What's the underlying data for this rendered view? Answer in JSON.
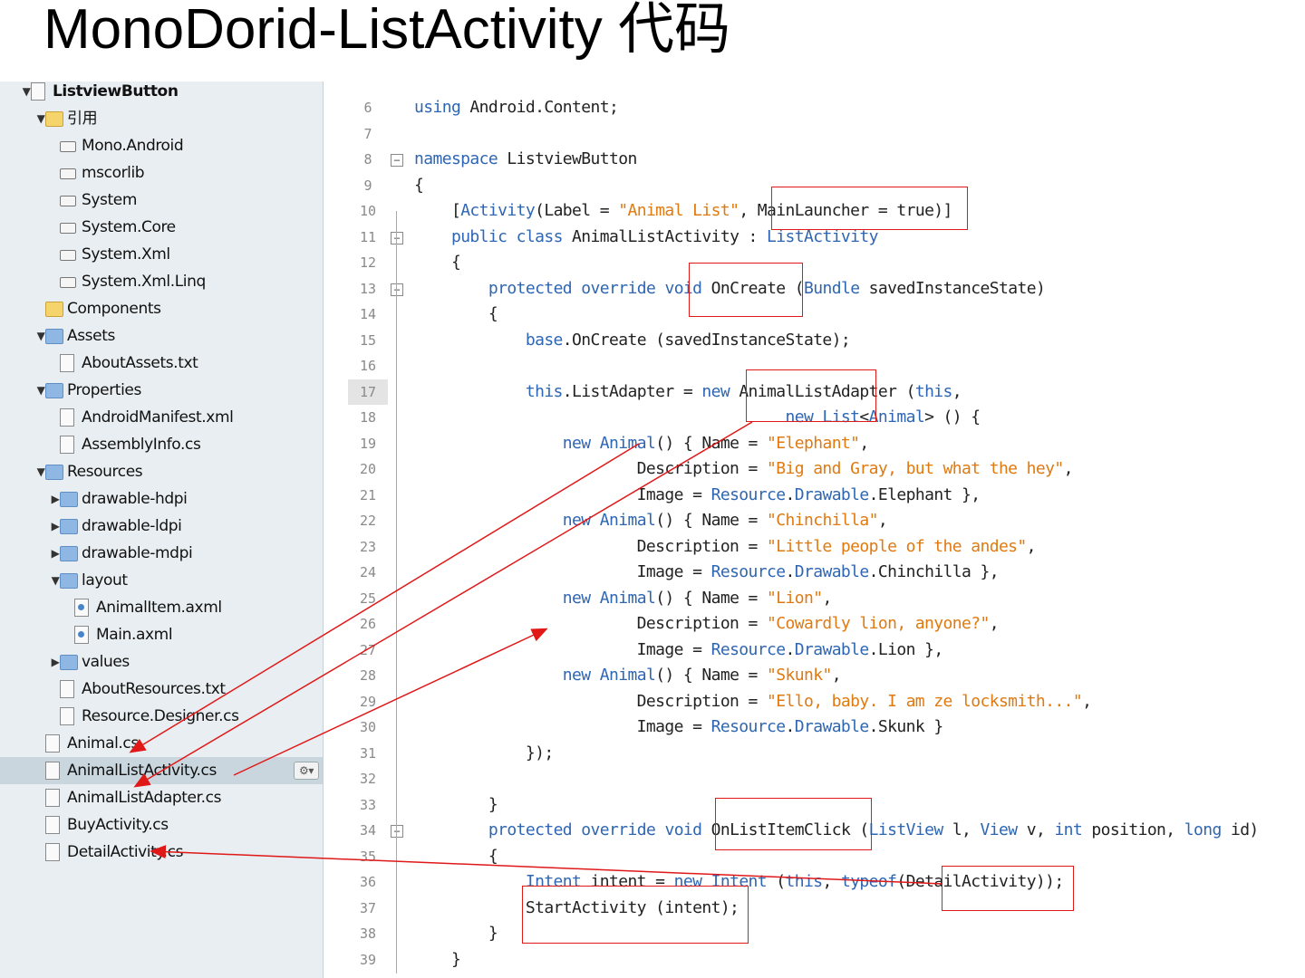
{
  "slide": {
    "title": "MonoDorid-ListActivity 代码"
  },
  "solution_tree": [
    {
      "label": "ListviewButton",
      "arrow": "▼",
      "icon": "project-icon"
    },
    {
      "label": "引用",
      "arrow": "▼",
      "icon": "folder-icon"
    },
    {
      "label": "Mono.Android",
      "arrow": "",
      "icon": "reference-icon"
    },
    {
      "label": "mscorlib",
      "arrow": "",
      "icon": "reference-icon"
    },
    {
      "label": "System",
      "arrow": "",
      "icon": "reference-icon"
    },
    {
      "label": "System.Core",
      "arrow": "",
      "icon": "reference-icon"
    },
    {
      "label": "System.Xml",
      "arrow": "",
      "icon": "reference-icon"
    },
    {
      "label": "System.Xml.Linq",
      "arrow": "",
      "icon": "reference-icon"
    },
    {
      "label": "Components",
      "arrow": "",
      "icon": "folder-icon"
    },
    {
      "label": "Assets",
      "arrow": "▼",
      "icon": "folder-icon"
    },
    {
      "label": "AboutAssets.txt",
      "arrow": "",
      "icon": "text-file-icon"
    },
    {
      "label": "Properties",
      "arrow": "▼",
      "icon": "folder-icon"
    },
    {
      "label": "AndroidManifest.xml",
      "arrow": "",
      "icon": "xml-file-icon"
    },
    {
      "label": "AssemblyInfo.cs",
      "arrow": "",
      "icon": "csharp-file-icon"
    },
    {
      "label": "Resources",
      "arrow": "▼",
      "icon": "folder-icon"
    },
    {
      "label": "drawable-hdpi",
      "arrow": "▶",
      "icon": "folder-icon"
    },
    {
      "label": "drawable-ldpi",
      "arrow": "▶",
      "icon": "folder-icon"
    },
    {
      "label": "drawable-mdpi",
      "arrow": "▶",
      "icon": "folder-icon"
    },
    {
      "label": "layout",
      "arrow": "▼",
      "icon": "folder-icon"
    },
    {
      "label": "AnimalItem.axml",
      "arrow": "",
      "icon": "axml-file-icon"
    },
    {
      "label": "Main.axml",
      "arrow": "",
      "icon": "axml-file-icon"
    },
    {
      "label": "values",
      "arrow": "▶",
      "icon": "folder-icon"
    },
    {
      "label": "AboutResources.txt",
      "arrow": "",
      "icon": "text-file-icon"
    },
    {
      "label": "Resource.Designer.cs",
      "arrow": "",
      "icon": "csharp-file-icon"
    },
    {
      "label": "Animal.cs",
      "arrow": "",
      "icon": "csharp-file-icon"
    },
    {
      "label": "AnimalListActivity.cs",
      "arrow": "",
      "icon": "csharp-file-icon",
      "selected": true
    },
    {
      "label": "AnimalListAdapter.cs",
      "arrow": "",
      "icon": "csharp-file-icon"
    },
    {
      "label": "BuyActivity.cs",
      "arrow": "",
      "icon": "csharp-file-icon"
    },
    {
      "label": "DetailActivity.cs",
      "arrow": "",
      "icon": "csharp-file-icon"
    }
  ],
  "gear_button": {
    "label": "⚙▾"
  },
  "editor": {
    "current_line": "17",
    "lines": [
      {
        "n": "6",
        "text": "using Android.Content;"
      },
      {
        "n": "7",
        "text": ""
      },
      {
        "n": "8",
        "text": "namespace ListviewButton"
      },
      {
        "n": "9",
        "text": "{"
      },
      {
        "n": "10",
        "text": "    [Activity(Label = \"Animal List\", MainLauncher = true)]"
      },
      {
        "n": "11",
        "text": "    public class AnimalListActivity : ListActivity"
      },
      {
        "n": "12",
        "text": "    {"
      },
      {
        "n": "13",
        "text": "        protected override void OnCreate (Bundle savedInstanceState)"
      },
      {
        "n": "14",
        "text": "        {"
      },
      {
        "n": "15",
        "text": "            base.OnCreate (savedInstanceState);"
      },
      {
        "n": "16",
        "text": ""
      },
      {
        "n": "17",
        "text": "            this.ListAdapter = new AnimalListAdapter (this,"
      },
      {
        "n": "18",
        "text": "                                        new List<Animal> () {"
      },
      {
        "n": "19",
        "text": "                new Animal() { Name = \"Elephant\","
      },
      {
        "n": "20",
        "text": "                        Description = \"Big and Gray, but what the hey\","
      },
      {
        "n": "21",
        "text": "                        Image = Resource.Drawable.Elephant },"
      },
      {
        "n": "22",
        "text": "                new Animal() { Name = \"Chinchilla\","
      },
      {
        "n": "23",
        "text": "                        Description = \"Little people of the andes\","
      },
      {
        "n": "24",
        "text": "                        Image = Resource.Drawable.Chinchilla },"
      },
      {
        "n": "25",
        "text": "                new Animal() { Name = \"Lion\","
      },
      {
        "n": "26",
        "text": "                        Description = \"Cowardly lion, anyone?\","
      },
      {
        "n": "27",
        "text": "                        Image = Resource.Drawable.Lion },"
      },
      {
        "n": "28",
        "text": "                new Animal() { Name = \"Skunk\","
      },
      {
        "n": "29",
        "text": "                        Description = \"Ello, baby. I am ze locksmith...\","
      },
      {
        "n": "30",
        "text": "                        Image = Resource.Drawable.Skunk }"
      },
      {
        "n": "31",
        "text": "            });"
      },
      {
        "n": "32",
        "text": ""
      },
      {
        "n": "33",
        "text": "        }"
      },
      {
        "n": "34",
        "text": "        protected override void OnListItemClick (ListView l, View v, int position, long id)"
      },
      {
        "n": "35",
        "text": "        {"
      },
      {
        "n": "36",
        "text": "            Intent intent = new Intent (this, typeof(DetailActivity));"
      },
      {
        "n": "37",
        "text": "            StartActivity (intent);"
      },
      {
        "n": "38",
        "text": "        }"
      },
      {
        "n": "39",
        "text": "    }"
      }
    ]
  },
  "annotations": {
    "color": "#e01818"
  }
}
